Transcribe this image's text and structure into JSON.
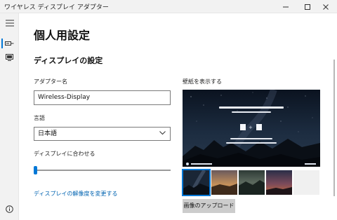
{
  "window": {
    "title": "ワイヤレス ディスプレイ アダプター",
    "minimize_icon": "minimize-icon",
    "maximize_icon": "maximize-icon",
    "close_icon": "close-icon"
  },
  "rail": {
    "items": [
      {
        "icon": "hamburger-menu-icon"
      },
      {
        "icon": "display-adapter-icon",
        "selected": true
      },
      {
        "icon": "monitor-icon"
      },
      {
        "icon": "info-icon"
      }
    ]
  },
  "page": {
    "title": "個人用設定",
    "section_title": "ディスプレイの設定"
  },
  "adapter_name": {
    "label": "アダプター名",
    "value": "Wireless-Display"
  },
  "language": {
    "label": "言語",
    "selected": "日本語"
  },
  "fit_display": {
    "label": "ディスプレイに合わせる",
    "value": 0.0
  },
  "resolution_link": "ディスプレイの解像度を変更する",
  "wallpaper": {
    "label": "壁紙を表示する",
    "selected_index": 0,
    "thumbnails": [
      {
        "name": "night-sky-mountains"
      },
      {
        "name": "sunset-desert"
      },
      {
        "name": "misty-valley"
      },
      {
        "name": "dusk-horizon"
      },
      {
        "name": "blank"
      }
    ],
    "upload_label": "画像のアップロード"
  },
  "colors": {
    "accent": "#0078d7",
    "link": "#0063b1",
    "rail_bg": "#f2f2f2",
    "button_bg": "#cccccc"
  }
}
